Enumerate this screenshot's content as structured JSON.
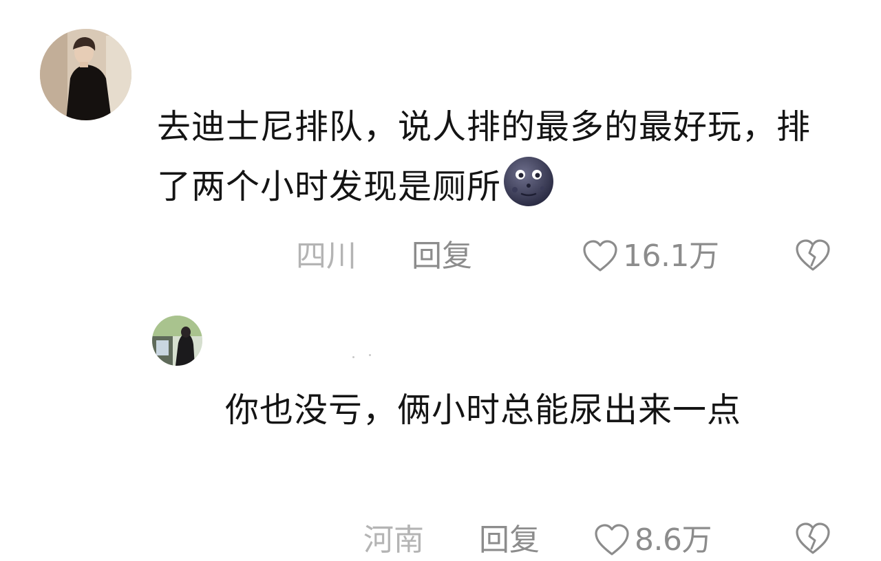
{
  "comments": [
    {
      "text": "去迪士尼排队，说人排的最多的最好玩，排了两个小时发现是厕所",
      "emoji": "new-moon-face-emoji",
      "location": "四川",
      "reply_label": "回复",
      "likes": "16.1万"
    }
  ],
  "replies": [
    {
      "text": "你也没亏，俩小时总能尿出来一点",
      "location": "河南",
      "reply_label": "回复",
      "likes": "8.6万"
    }
  ],
  "icons": {
    "like": "heart-outline-icon",
    "dislike": "broken-heart-icon"
  },
  "colors": {
    "text": "#141414",
    "meta": "#8c8c8c",
    "location": "#b4b4b4",
    "background": "#ffffff"
  }
}
